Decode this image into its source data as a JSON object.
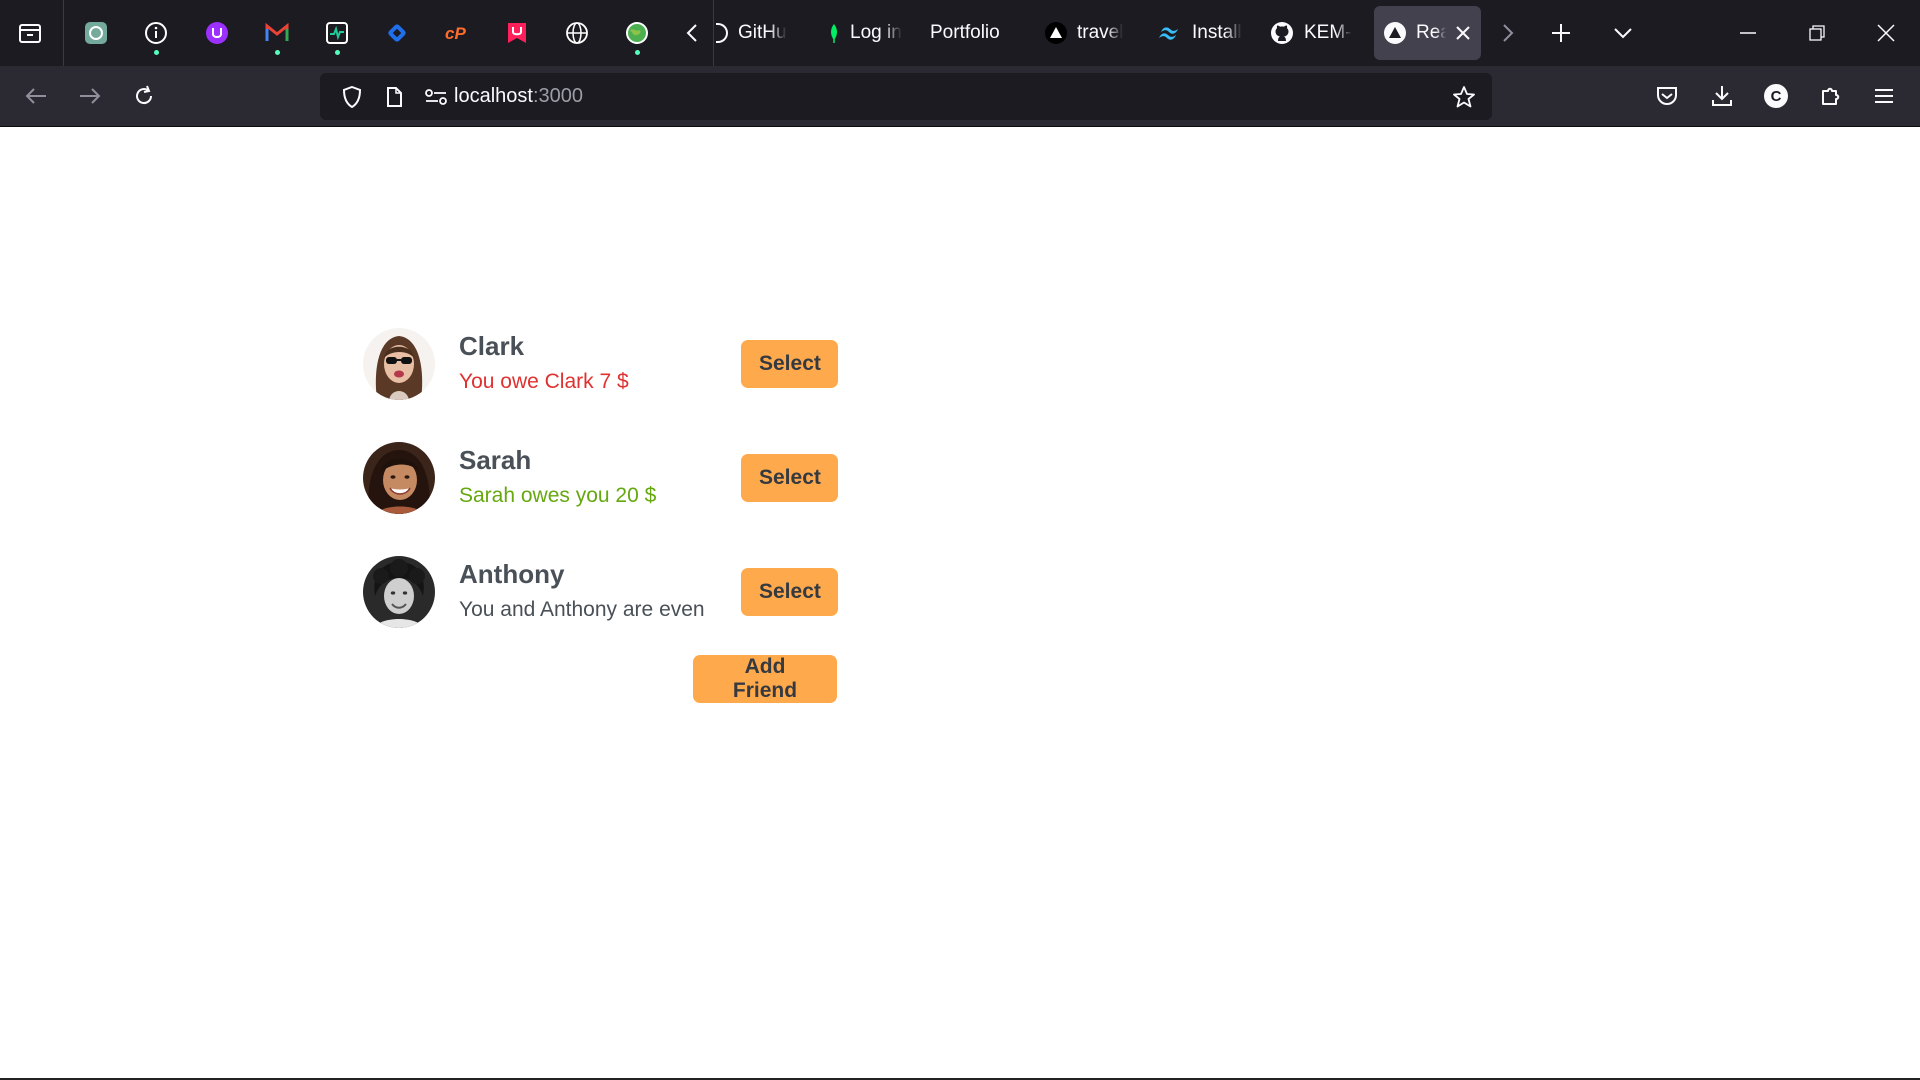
{
  "browser": {
    "pinned_tabs": [
      {
        "icon": "openai-icon",
        "color": "#74aa9c",
        "dot": false
      },
      {
        "icon": "info-icon",
        "color": "#ffffff",
        "dot": true
      },
      {
        "icon": "ublock-u-icon",
        "color": "#9b30ff",
        "dot": false
      },
      {
        "icon": "gmail-icon",
        "color": "#ea4335",
        "dot": true
      },
      {
        "icon": "activity-monitor-icon",
        "color": "#20c997",
        "dot": true
      },
      {
        "icon": "diamond-icon",
        "color": "#1f6feb",
        "dot": false
      },
      {
        "icon": "cpanel-icon",
        "color": "#ff6c2c",
        "dot": false
      },
      {
        "icon": "u-logo-icon",
        "color": "#ff1f5a",
        "dot": false
      },
      {
        "icon": "globe-icon",
        "color": "#ffffff",
        "dot": false
      },
      {
        "icon": "earth-icon",
        "color": "#4caf50",
        "dot": true
      }
    ],
    "tabs": [
      {
        "label": "GitHu",
        "icon": "github-partial-icon"
      },
      {
        "label": "Log in",
        "icon": "leaf-icon"
      },
      {
        "label": "Portfolio",
        "icon": ""
      },
      {
        "label": "travel",
        "icon": "triangle-icon"
      },
      {
        "label": "Install",
        "icon": "tailwind-icon"
      },
      {
        "label": "KEM-",
        "icon": "github-icon"
      },
      {
        "label": "Rea",
        "icon": "triangle-icon"
      }
    ],
    "url": {
      "host": "localhost",
      "port": ":3000"
    }
  },
  "friends": [
    {
      "name": "Clark",
      "status": "You owe Clark 7 $",
      "status_type": "owe",
      "avatar": "clark-avatar"
    },
    {
      "name": "Sarah",
      "status": "Sarah owes you 20 $",
      "status_type": "owed",
      "avatar": "sarah-avatar"
    },
    {
      "name": "Anthony",
      "status": "You and Anthony are even",
      "status_type": "even",
      "avatar": "anthony-avatar"
    }
  ],
  "buttons": {
    "select_label": "Select",
    "add_friend_label": "Add Friend"
  },
  "colors": {
    "accent": "#ffa94d",
    "owe": "#e03131",
    "owed": "#66a80f",
    "text": "#495057"
  }
}
